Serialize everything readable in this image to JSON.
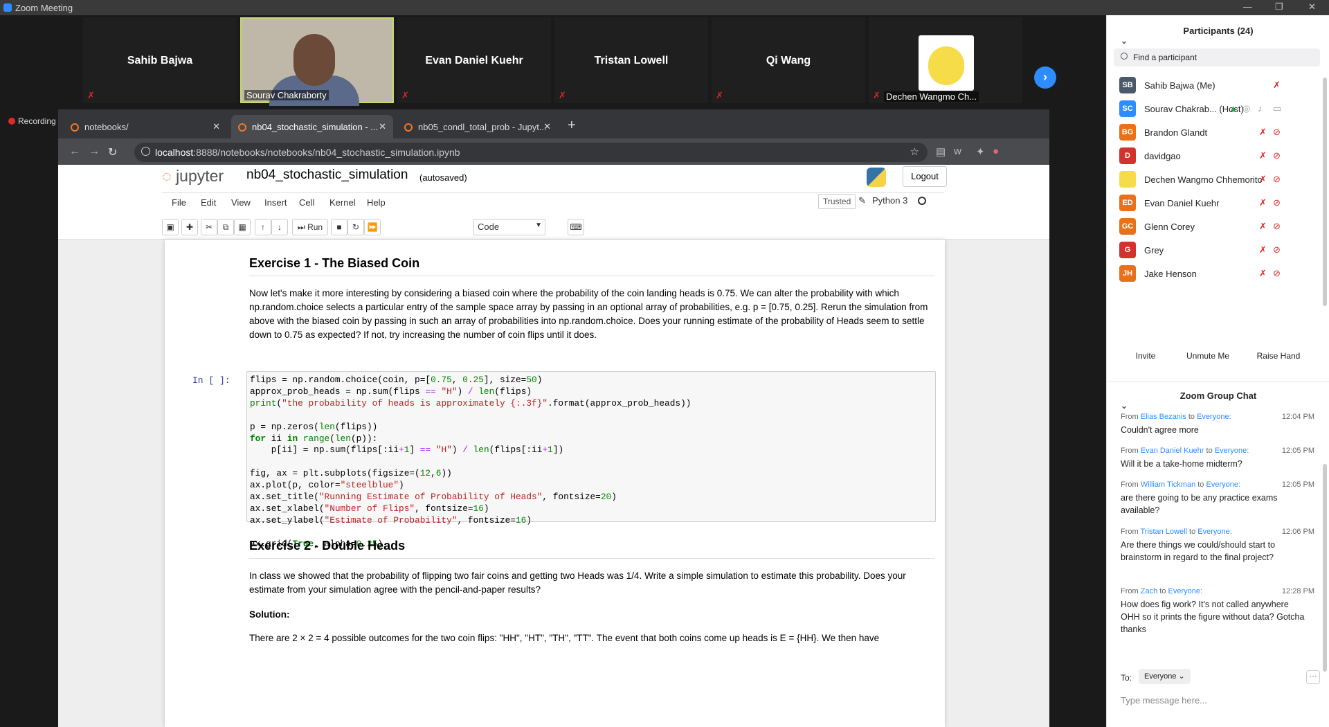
{
  "window": {
    "title": "Zoom Meeting"
  },
  "gallery": {
    "tiles": [
      {
        "name": "Sahib Bajwa"
      },
      {
        "name": "Sourav Chakraborty"
      },
      {
        "name": "Evan Daniel Kuehr"
      },
      {
        "name": "Tristan Lowell"
      },
      {
        "name": "Qi Wang"
      },
      {
        "name": "Dechen Wangmo Ch..."
      }
    ]
  },
  "recording": {
    "label": "Recording"
  },
  "browser": {
    "tabs": [
      {
        "title": "notebooks/"
      },
      {
        "title": "nb04_stochastic_simulation - ..."
      },
      {
        "title": "nb05_condl_total_prob - Jupyt..."
      }
    ],
    "url_host": "localhost",
    "url_path": ":8888/notebooks/notebooks/nb04_stochastic_simulation.ipynb"
  },
  "jupyter": {
    "logo": "jupyter",
    "notebook_name": "nb04_stochastic_simulation",
    "autosave": "(autosaved)",
    "logout": "Logout",
    "menu": [
      "File",
      "Edit",
      "View",
      "Insert",
      "Cell",
      "Kernel",
      "Help"
    ],
    "trusted": "Trusted",
    "kernel": "Python 3",
    "run_label": "Run",
    "cell_type": "Code"
  },
  "notebook": {
    "ex1_title": "Exercise 1 - The Biased Coin",
    "ex1_text": "Now let's make it more interesting by considering a biased coin where the probability of the coin landing heads is 0.75. We can alter the probability with which np.random.choice selects a particular entry of the sample space array by passing in an optional array of probabilities, e.g. p = [0.75, 0.25]. Rerun the simulation from above with the biased coin by passing in such an array of probabilities into np.random.choice. Does your running estimate of the probability of Heads seem to settle down to 0.75 as expected? If not, try increasing the number of coin flips until it does.",
    "prompt": "In [ ]:",
    "ex2_title": "Exercise 2 - Double Heads",
    "ex2_text": "In class we showed that the probability of flipping two fair coins and getting two Heads was 1/4. Write a simple simulation to estimate this probability. Does your estimate from your simulation agree with the pencil-and-paper results?",
    "solution_label": "Solution:",
    "solution_text": "There are 2 × 2 = 4 possible outcomes for the two coin flips: \"HH\", \"HT\", \"TH\", \"TT\". The event that both coins come up heads is E = {HH}. We then have"
  },
  "participants": {
    "header": "Participants (24)",
    "search_placeholder": "Find a participant",
    "list": [
      {
        "initials": "SB",
        "name": "Sahib Bajwa (Me)",
        "color": "#4a5a6a"
      },
      {
        "initials": "SC",
        "name": "Sourav Chakrab... (Host)",
        "color": "#2d8cff"
      },
      {
        "initials": "BG",
        "name": "Brandon Glandt",
        "color": "#e8711a"
      },
      {
        "initials": "D",
        "name": "davidgao",
        "color": "#d0342c"
      },
      {
        "initials": "",
        "name": "Dechen Wangmo Chhemorito",
        "color": "#f7dc4a"
      },
      {
        "initials": "ED",
        "name": "Evan Daniel Kuehr",
        "color": "#e8711a"
      },
      {
        "initials": "GC",
        "name": "Glenn Corey",
        "color": "#e8711a"
      },
      {
        "initials": "G",
        "name": "Grey",
        "color": "#d0342c"
      },
      {
        "initials": "JH",
        "name": "Jake Henson",
        "color": "#e8711a"
      }
    ],
    "buttons": [
      "Invite",
      "Unmute Me",
      "Raise Hand"
    ]
  },
  "chat": {
    "header": "Zoom Group Chat",
    "messages": [
      {
        "from": "Elias Bezanis",
        "to": "Everyone:",
        "time": "12:04 PM",
        "text": "Couldn't agree more"
      },
      {
        "from": "Evan Daniel Kuehr",
        "to": "Everyone:",
        "time": "12:05 PM",
        "text": "Will it be a take-home midterm?"
      },
      {
        "from": "William Tickman",
        "to": "Everyone:",
        "time": "12:05 PM",
        "text": "are there going to be any practice exams available?"
      },
      {
        "from": "Tristan Lowell",
        "to": "Everyone:",
        "time": "12:06 PM",
        "text": "Are there things we could/should start to brainstorm in regard to the final project?"
      },
      {
        "from": "Zach",
        "to": "Everyone:",
        "time": "12:28 PM",
        "text": "How does fig work? It's not called anywhere\nOHH so it prints the figure without data? Gotcha thanks"
      }
    ],
    "from_word": "From",
    "to_word": "to",
    "to_label": "To:",
    "to_value": "Everyone",
    "input_placeholder": "Type message here..."
  }
}
